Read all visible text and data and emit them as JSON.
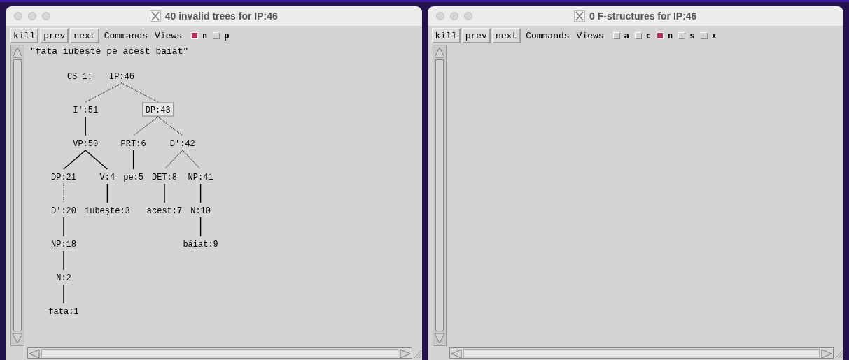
{
  "windows": [
    {
      "title": "40 invalid trees for IP:46",
      "buttons": [
        "kill",
        "prev",
        "next"
      ],
      "menus": [
        "Commands",
        "Views"
      ],
      "toggles": [
        {
          "label": "n",
          "checked": true
        },
        {
          "label": "p",
          "checked": false
        }
      ],
      "sentence": "\"fata iubește pe acest băiat\"",
      "tree": {
        "label": "CS 1:",
        "root": {
          "label": "IP:46",
          "selected": false,
          "children": [
            {
              "label": "I':51",
              "selected": false,
              "dotted": true,
              "children": [
                {
                  "label": "VP:50",
                  "selected": false,
                  "dotted": false,
                  "children": [
                    {
                      "label": "DP:21",
                      "selected": false,
                      "dotted": false,
                      "children": [
                        {
                          "label": "D':20",
                          "selected": false,
                          "dotted": true,
                          "children": [
                            {
                              "label": "NP:18",
                              "selected": false,
                              "dotted": false,
                              "children": [
                                {
                                  "label": "N:2",
                                  "selected": false,
                                  "dotted": false,
                                  "children": [
                                    {
                                      "label": "fata:1",
                                      "selected": false,
                                      "dotted": false
                                    }
                                  ]
                                }
                              ]
                            }
                          ]
                        }
                      ]
                    },
                    {
                      "label": "V:4",
                      "selected": false,
                      "dotted": false,
                      "children": [
                        {
                          "label": "iubește:3",
                          "selected": false,
                          "dotted": false
                        }
                      ]
                    }
                  ]
                }
              ]
            },
            {
              "label": "DP:43",
              "selected": true,
              "dotted": true,
              "children": [
                {
                  "label": "PRT:6",
                  "selected": false,
                  "dotted": true,
                  "children": [
                    {
                      "label": "pe:5",
                      "selected": false,
                      "dotted": false
                    }
                  ]
                },
                {
                  "label": "D':42",
                  "selected": false,
                  "dotted": true,
                  "children": [
                    {
                      "label": "DET:8",
                      "selected": false,
                      "dotted": true,
                      "children": [
                        {
                          "label": "acest:7",
                          "selected": false,
                          "dotted": false
                        }
                      ]
                    },
                    {
                      "label": "NP:41",
                      "selected": false,
                      "dotted": true,
                      "children": [
                        {
                          "label": "N:10",
                          "selected": false,
                          "dotted": false,
                          "children": [
                            {
                              "label": "băiat:9",
                              "selected": false,
                              "dotted": false
                            }
                          ]
                        }
                      ]
                    }
                  ]
                }
              ]
            }
          ]
        }
      }
    },
    {
      "title": "0 F-structures for IP:46",
      "buttons": [
        "kill",
        "prev",
        "next"
      ],
      "menus": [
        "Commands",
        "Views"
      ],
      "toggles": [
        {
          "label": "a",
          "checked": false
        },
        {
          "label": "c",
          "checked": false
        },
        {
          "label": "n",
          "checked": true
        },
        {
          "label": "s",
          "checked": false
        },
        {
          "label": "x",
          "checked": false
        }
      ]
    }
  ]
}
